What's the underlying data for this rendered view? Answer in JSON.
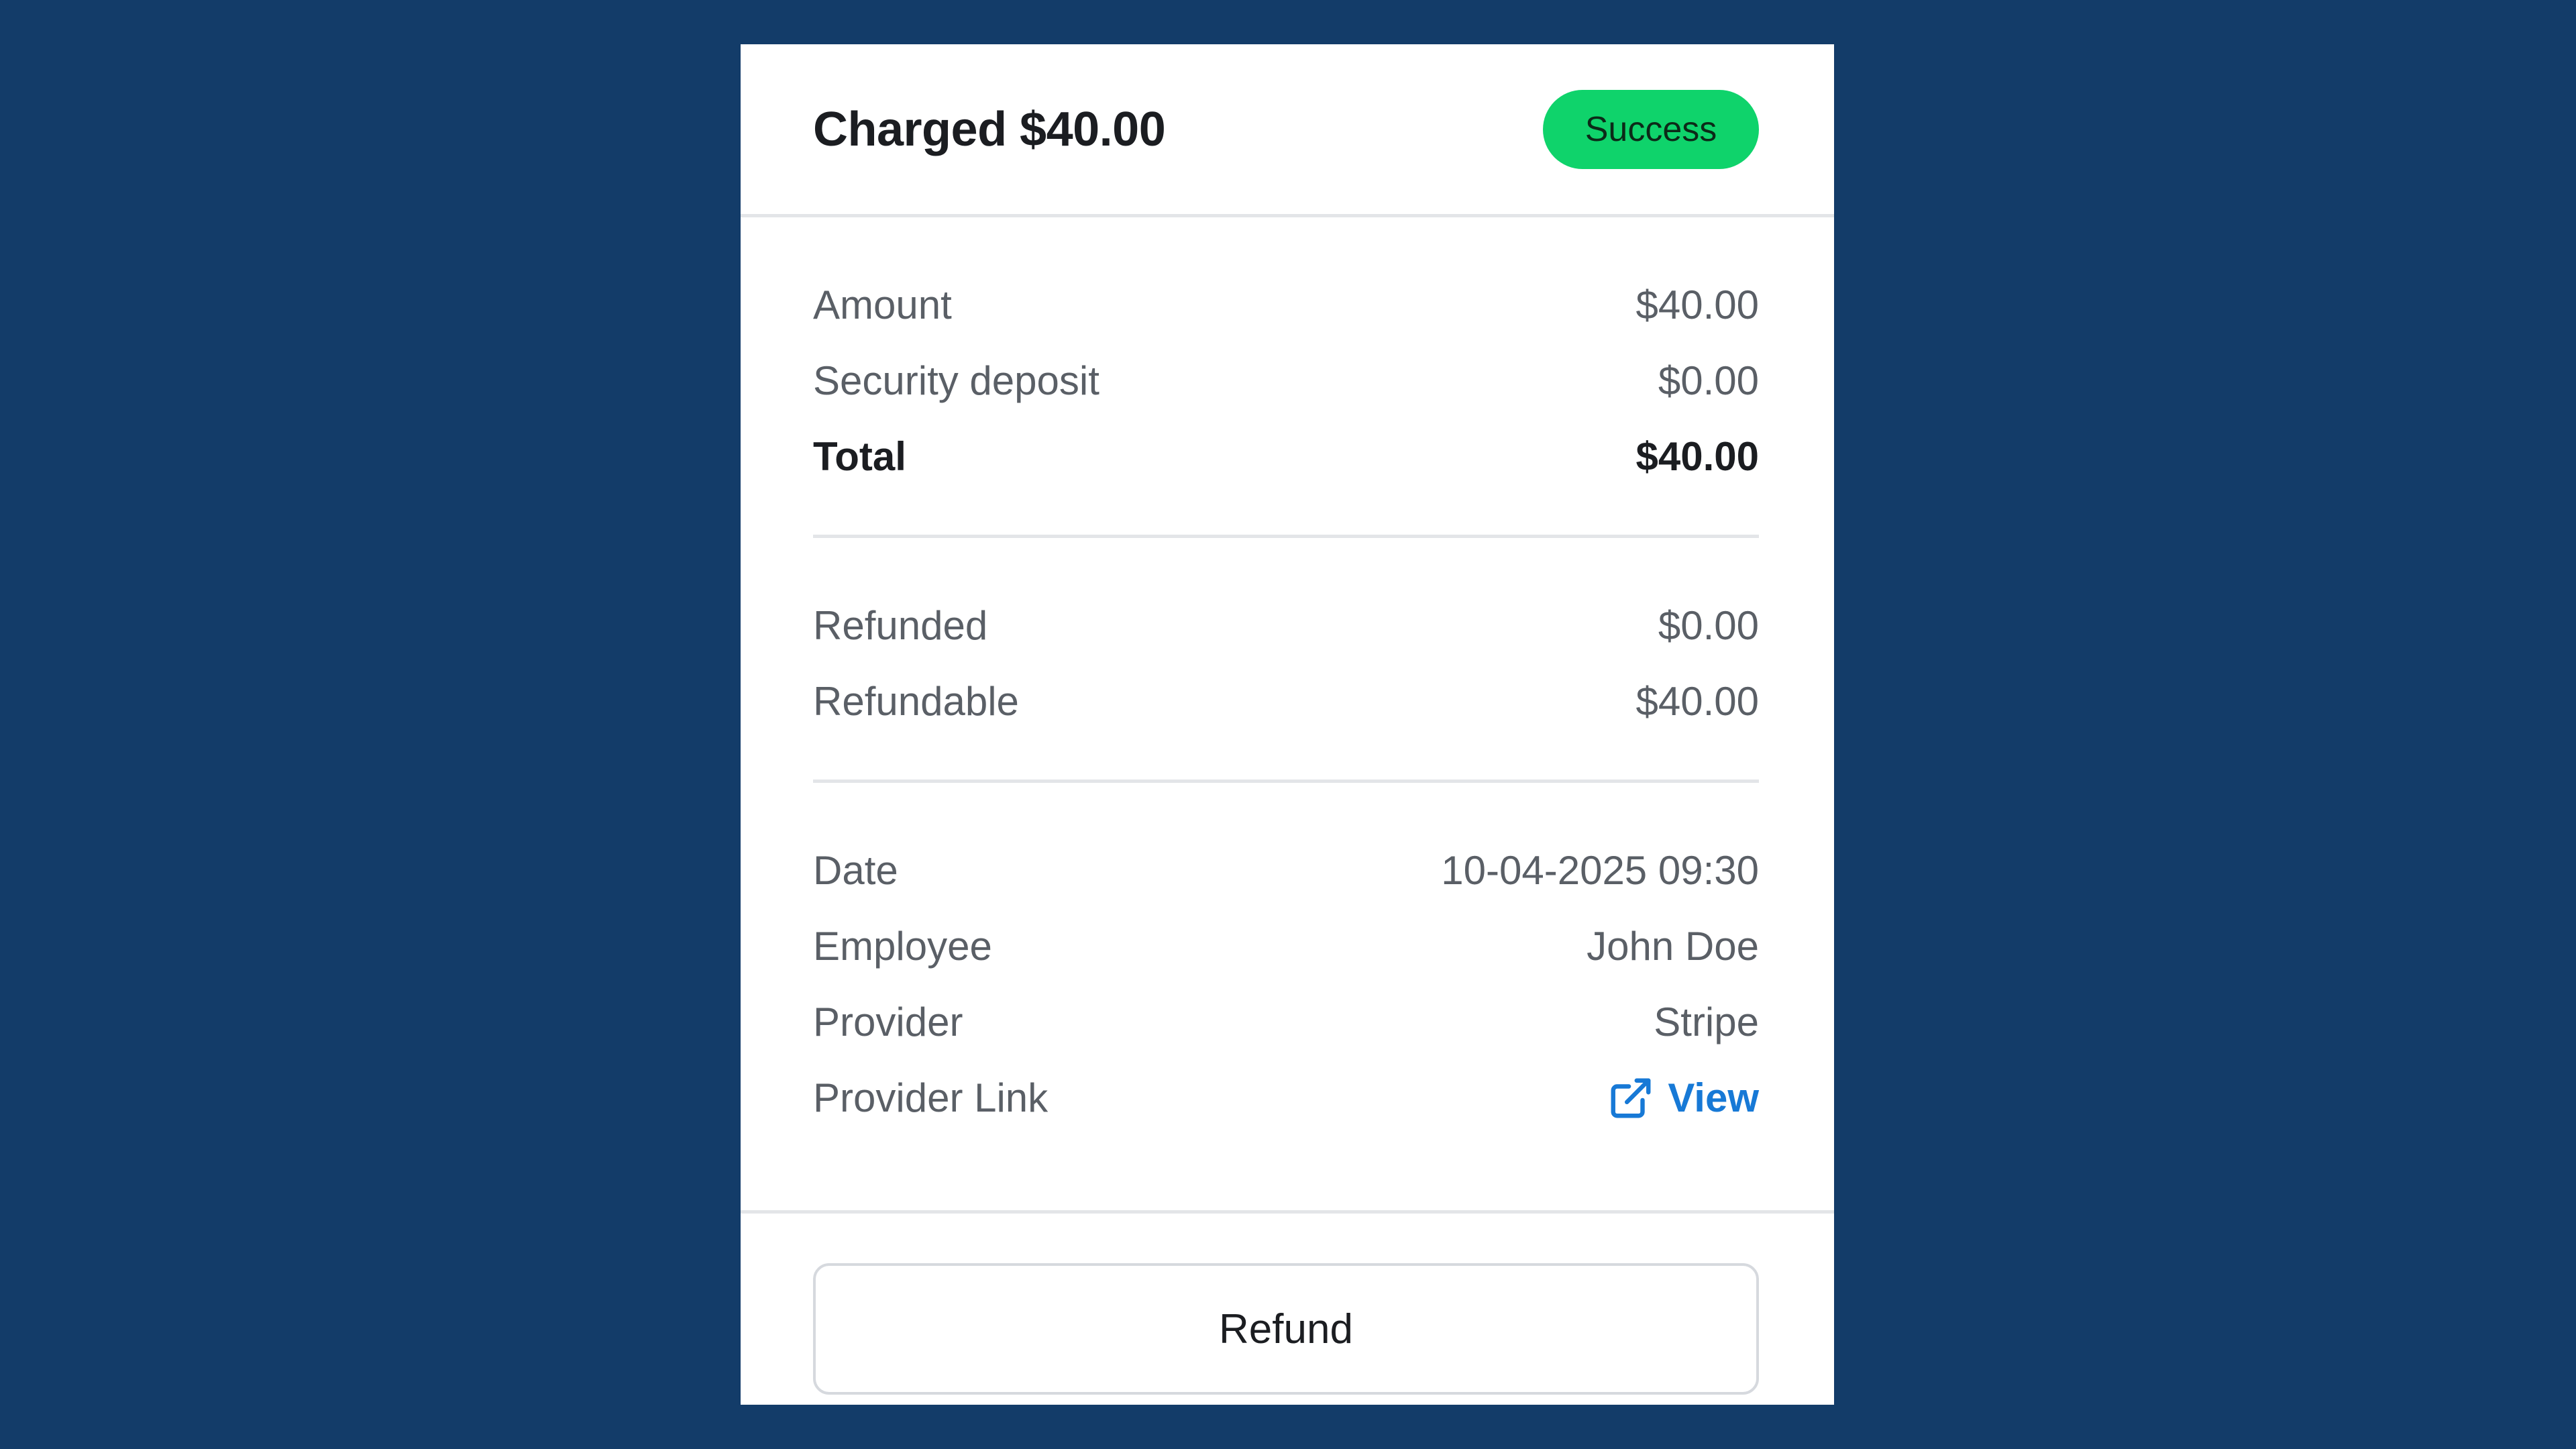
{
  "header": {
    "title": "Charged $40.00",
    "status": "Success",
    "status_color": "#0fd36b"
  },
  "summary": [
    {
      "label": "Amount",
      "value": "$40.00"
    },
    {
      "label": "Security deposit",
      "value": "$0.00"
    },
    {
      "label": "Total",
      "value": "$40.00"
    }
  ],
  "refunds": [
    {
      "label": "Refunded",
      "value": "$0.00"
    },
    {
      "label": "Refundable",
      "value": "$40.00"
    }
  ],
  "details": [
    {
      "label": "Date",
      "value": "10-04-2025 09:30"
    },
    {
      "label": "Employee",
      "value": "John Doe"
    },
    {
      "label": "Provider",
      "value": "Stripe"
    },
    {
      "label": "Provider Link",
      "value": "View",
      "icon": "external-link-icon"
    }
  ],
  "footer": {
    "refund_label": "Refund"
  },
  "colors": {
    "background": "#133c69",
    "link": "#1779d6"
  }
}
